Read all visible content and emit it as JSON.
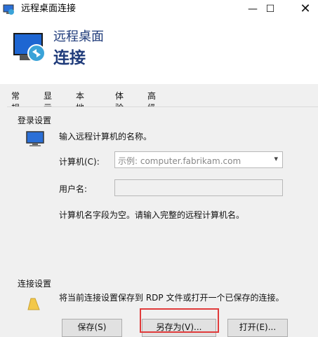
{
  "window": {
    "title": "远程桌面连接",
    "minimize": "—",
    "maximize": "☐",
    "close": "✕"
  },
  "header": {
    "line1": "远程桌面",
    "line2": "连接"
  },
  "tabs": [
    "常规",
    "显示",
    "本地资源",
    "体验",
    "高级"
  ],
  "login": {
    "group_label": "登录设置",
    "instruction": "输入远程计算机的名称。",
    "computer_label": "计算机(C):",
    "computer_placeholder": "示例: computer.fabrikam.com",
    "user_label": "用户名:",
    "hint": "计算机名字段为空。请输入完整的远程计算机名。"
  },
  "connection": {
    "group_label": "连接设置",
    "description": "将当前连接设置保存到 RDP 文件或打开一个已保存的连接。"
  },
  "buttons": {
    "save": "保存(S)",
    "save_as": "另存为(V)...",
    "open": "打开(E)..."
  },
  "colors": {
    "accent": "#1f3b7a",
    "highlight": "#e03b3b"
  }
}
